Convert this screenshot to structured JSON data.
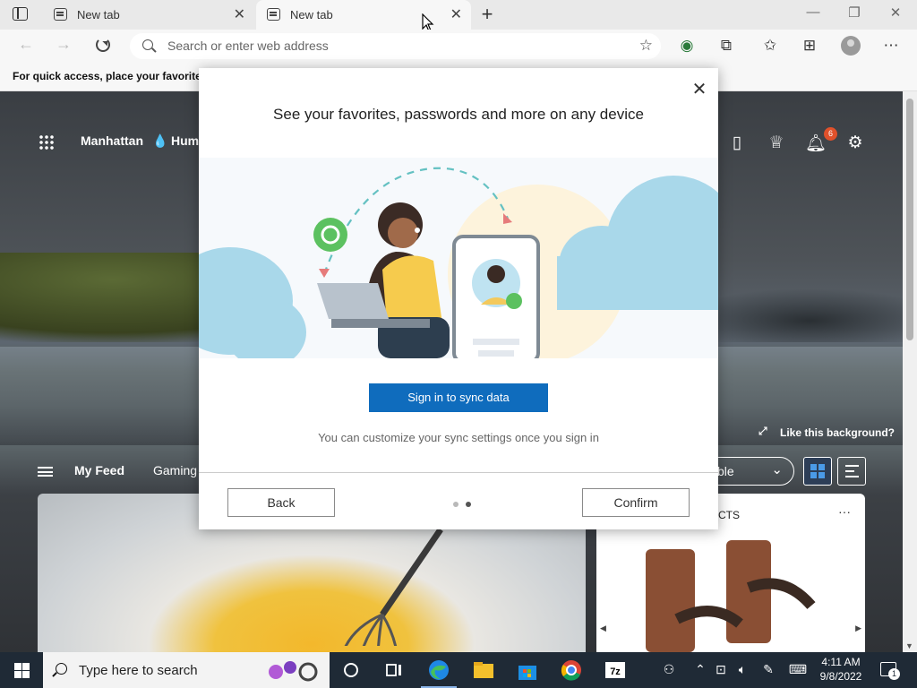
{
  "tabs": [
    {
      "title": "New tab"
    },
    {
      "title": "New tab"
    }
  ],
  "address_bar": {
    "placeholder": "Search or enter web address"
  },
  "favorites_bar": {
    "hint": "For quick access, place your favorites h"
  },
  "ntp": {
    "location": "Manhattan",
    "weather": "Hum",
    "notification_count": "6",
    "background_link": "Like this background?",
    "feed_tabs": [
      "My Feed",
      "Gaming"
    ],
    "layout_select": "ble",
    "card_right_label": "CTS",
    "card_more": "···"
  },
  "modal": {
    "title": "See your favorites, passwords and more on any device",
    "primary_button": "Sign in to sync data",
    "note": "You can customize your sync settings once you sign in",
    "back_button": "Back",
    "confirm_button": "Confirm",
    "page_indicator": {
      "total": 2,
      "current": 2
    }
  },
  "taskbar": {
    "search_placeholder": "Type here to search",
    "time": "4:11 AM",
    "date": "9/8/2022",
    "notification_count": "1",
    "pinned_apps": [
      "task-view-icon",
      "edge-icon",
      "file-explorer-icon",
      "store-icon",
      "chrome-icon",
      "7zip-icon"
    ]
  },
  "colors": {
    "accent": "#0f6cbd",
    "badge": "#e0512b",
    "taskbar": "#1f2a36"
  }
}
